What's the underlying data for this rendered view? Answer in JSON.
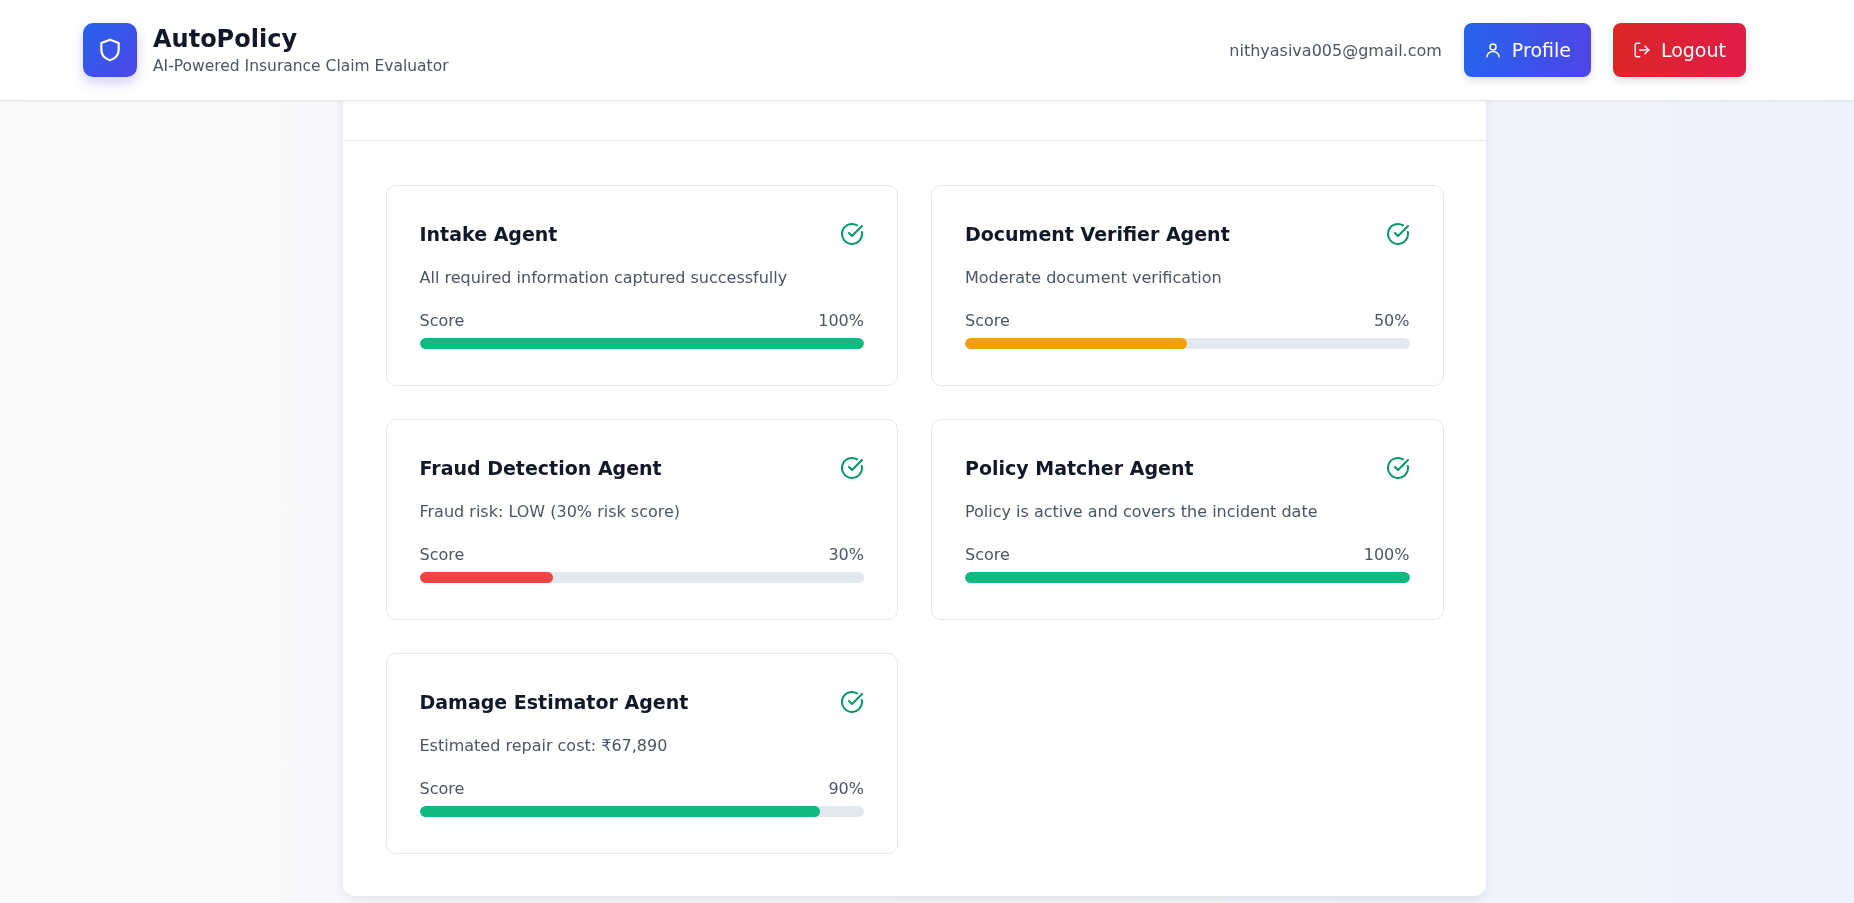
{
  "header": {
    "app_name": "AutoPolicy",
    "tagline": "AI-Powered Insurance Claim Evaluator",
    "user_email": "nithyasiva005@gmail.com",
    "buttons": [
      {
        "kind": "profile",
        "label": "Profile"
      },
      {
        "kind": "logout",
        "label": "Logout"
      }
    ]
  },
  "agents": [
    {
      "name": "Intake Agent",
      "passed": true,
      "summary": "All required information captured successfully",
      "score_label": "Score",
      "score": "100%",
      "level": 1.0
    },
    {
      "name": "Document Verifier Agent",
      "passed": true,
      "summary": "Moderate document verification",
      "score_label": "Score",
      "score": "50%",
      "level": 0.5
    },
    {
      "name": "Fraud Detection Agent",
      "passed": true,
      "summary": "Fraud risk: LOW (30% risk score)",
      "score_label": "Score",
      "score": "30%",
      "level": 0.3
    },
    {
      "name": "Policy Matcher Agent",
      "passed": true,
      "summary": "Policy is active and covers the incident date",
      "score_label": "Score",
      "score": "100%",
      "level": 1.0
    },
    {
      "name": "Damage Estimator Agent",
      "passed": true,
      "summary": "Estimated repair cost: ₹67,890",
      "score_label": "Score",
      "score": "90%",
      "level": 0.9
    }
  ]
}
